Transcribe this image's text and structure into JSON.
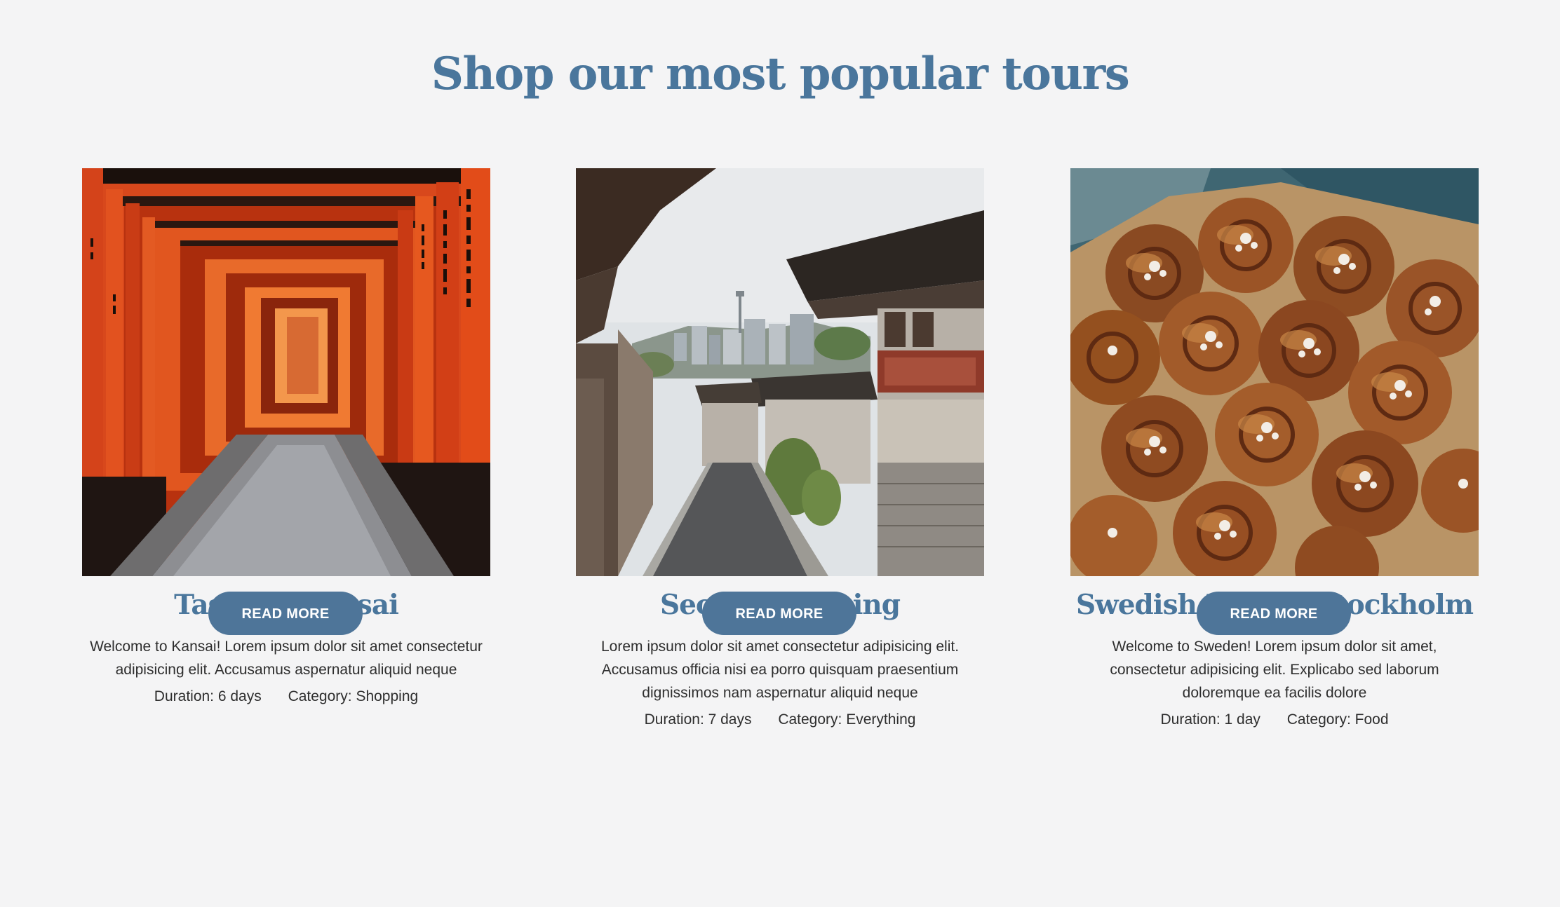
{
  "section": {
    "title": "Shop our most popular tours"
  },
  "tours": [
    {
      "title": "Taste of Kansai",
      "description": "Welcome to Kansai! Lorem ipsum dolor sit amet consectetur adipisicing elit. Accusamus aspernatur aliquid neque",
      "duration": "Duration: 6 days",
      "category": "Category: Shopping",
      "button_label": "READ MORE",
      "image_subject": "torii-gates-corridor"
    },
    {
      "title": "Seoul Searching",
      "description": "Lorem ipsum dolor sit amet consectetur adipisicing elit. Accusamus officia nisi ea porro quisquam praesentium dignissimos nam aspernatur aliquid neque",
      "duration": "Duration: 7 days",
      "category": "Category: Everything",
      "button_label": "READ MORE",
      "image_subject": "hanok-village-street"
    },
    {
      "title": "Swedish Fika in Stockholm",
      "description": "Welcome to Sweden! Lorem ipsum dolor sit amet, consectetur adipisicing elit. Explicabo sed laborum doloremque ea facilis dolore",
      "duration": "Duration: 1 day",
      "category": "Category: Food",
      "button_label": "READ MORE",
      "image_subject": "cinnamon-buns"
    }
  ],
  "colors": {
    "background": "#f4f4f5",
    "heading": "#4a769c",
    "button": "#4e7599",
    "button_text": "#ffffff",
    "body_text": "#2e2e2e"
  }
}
